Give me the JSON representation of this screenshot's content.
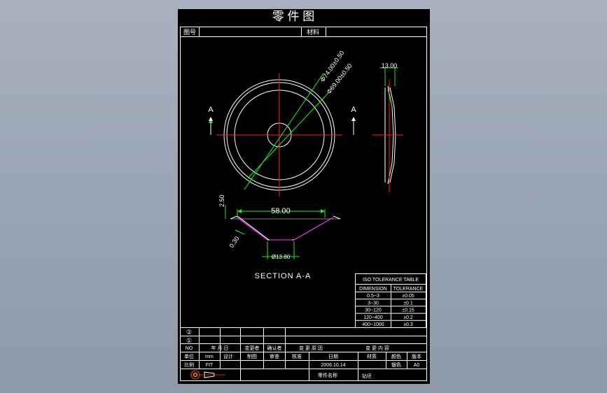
{
  "drawing": {
    "title": "零 件 图",
    "header": {
      "drawing_no_label": "图号",
      "material_label": "材料"
    },
    "section_labels": {
      "left": "A",
      "right": "A"
    },
    "section_title": "SECTION  A-A",
    "dimensions": {
      "outer_diameter": "Φ74.00±0.50",
      "inner_diameter": "Φ69.00±0.50",
      "thickness": "13.00",
      "depth": "2.50",
      "top_width": "58.00",
      "wall": "0.30",
      "bottom_diameter": "Ø13.80"
    },
    "tolerance_table": {
      "title": "ISO TOLERANCE TABLE",
      "headers": [
        "DIMENSION",
        "TOLERANCE"
      ],
      "rows": [
        [
          "0.5~3",
          "±0.05"
        ],
        [
          "3~30",
          "±0.1"
        ],
        [
          "30~120",
          "±0.15"
        ],
        [
          "120~400",
          "±0.2"
        ],
        [
          "400~1000",
          "±0.3"
        ]
      ]
    },
    "title_block": {
      "rev_markers": [
        "②",
        "①"
      ],
      "row_no": [
        "NO",
        "年  月  日",
        "变更者",
        "确认者",
        "变 更 原 因",
        "变 更 内 容"
      ],
      "row_unit": [
        "单位",
        "mm",
        "设计",
        "制图",
        "审查",
        "核准",
        "日期",
        "材质",
        "颜色",
        "版本"
      ],
      "row_scale": [
        "比例",
        "FIT",
        "",
        "",
        "",
        "",
        "2006.10.14",
        "",
        "银色",
        "A0"
      ],
      "row_name": [
        "零件名称",
        "钻坯"
      ]
    },
    "colors": {
      "background": "#000000",
      "lines": "#ffffff",
      "center_lines": "#ff2020",
      "dimension_lines": "#22ee22",
      "cone_profile": "#ff33ff",
      "arrow_marker": "#ffff33"
    }
  }
}
